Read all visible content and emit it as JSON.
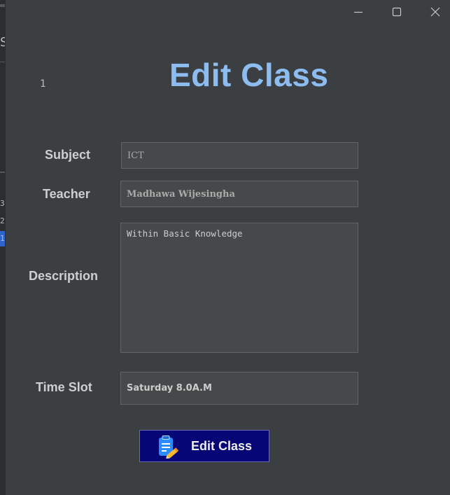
{
  "window": {
    "controls": {
      "minimize": "minimize",
      "maximize": "maximize",
      "close": "close"
    }
  },
  "background": {
    "chars": [
      "S",
      "3",
      "2",
      "1"
    ]
  },
  "dialog": {
    "id_value": "1",
    "title": "Edit Class",
    "subject": {
      "label": "Subject",
      "value": "ICT"
    },
    "teacher": {
      "label": "Teacher",
      "value": "Madhawa Wijesingha"
    },
    "description": {
      "label": "Description",
      "value": "Within Basic Knowledge"
    },
    "time_slot": {
      "label": "Time Slot",
      "value": "Saturday 8.0A.M"
    },
    "submit": {
      "label": "Edit Class",
      "icon": "clipboard-edit-icon"
    }
  },
  "colors": {
    "background": "#3c3f41",
    "title": "#8cbcf0",
    "button": "#060676",
    "field": "#45494a"
  }
}
